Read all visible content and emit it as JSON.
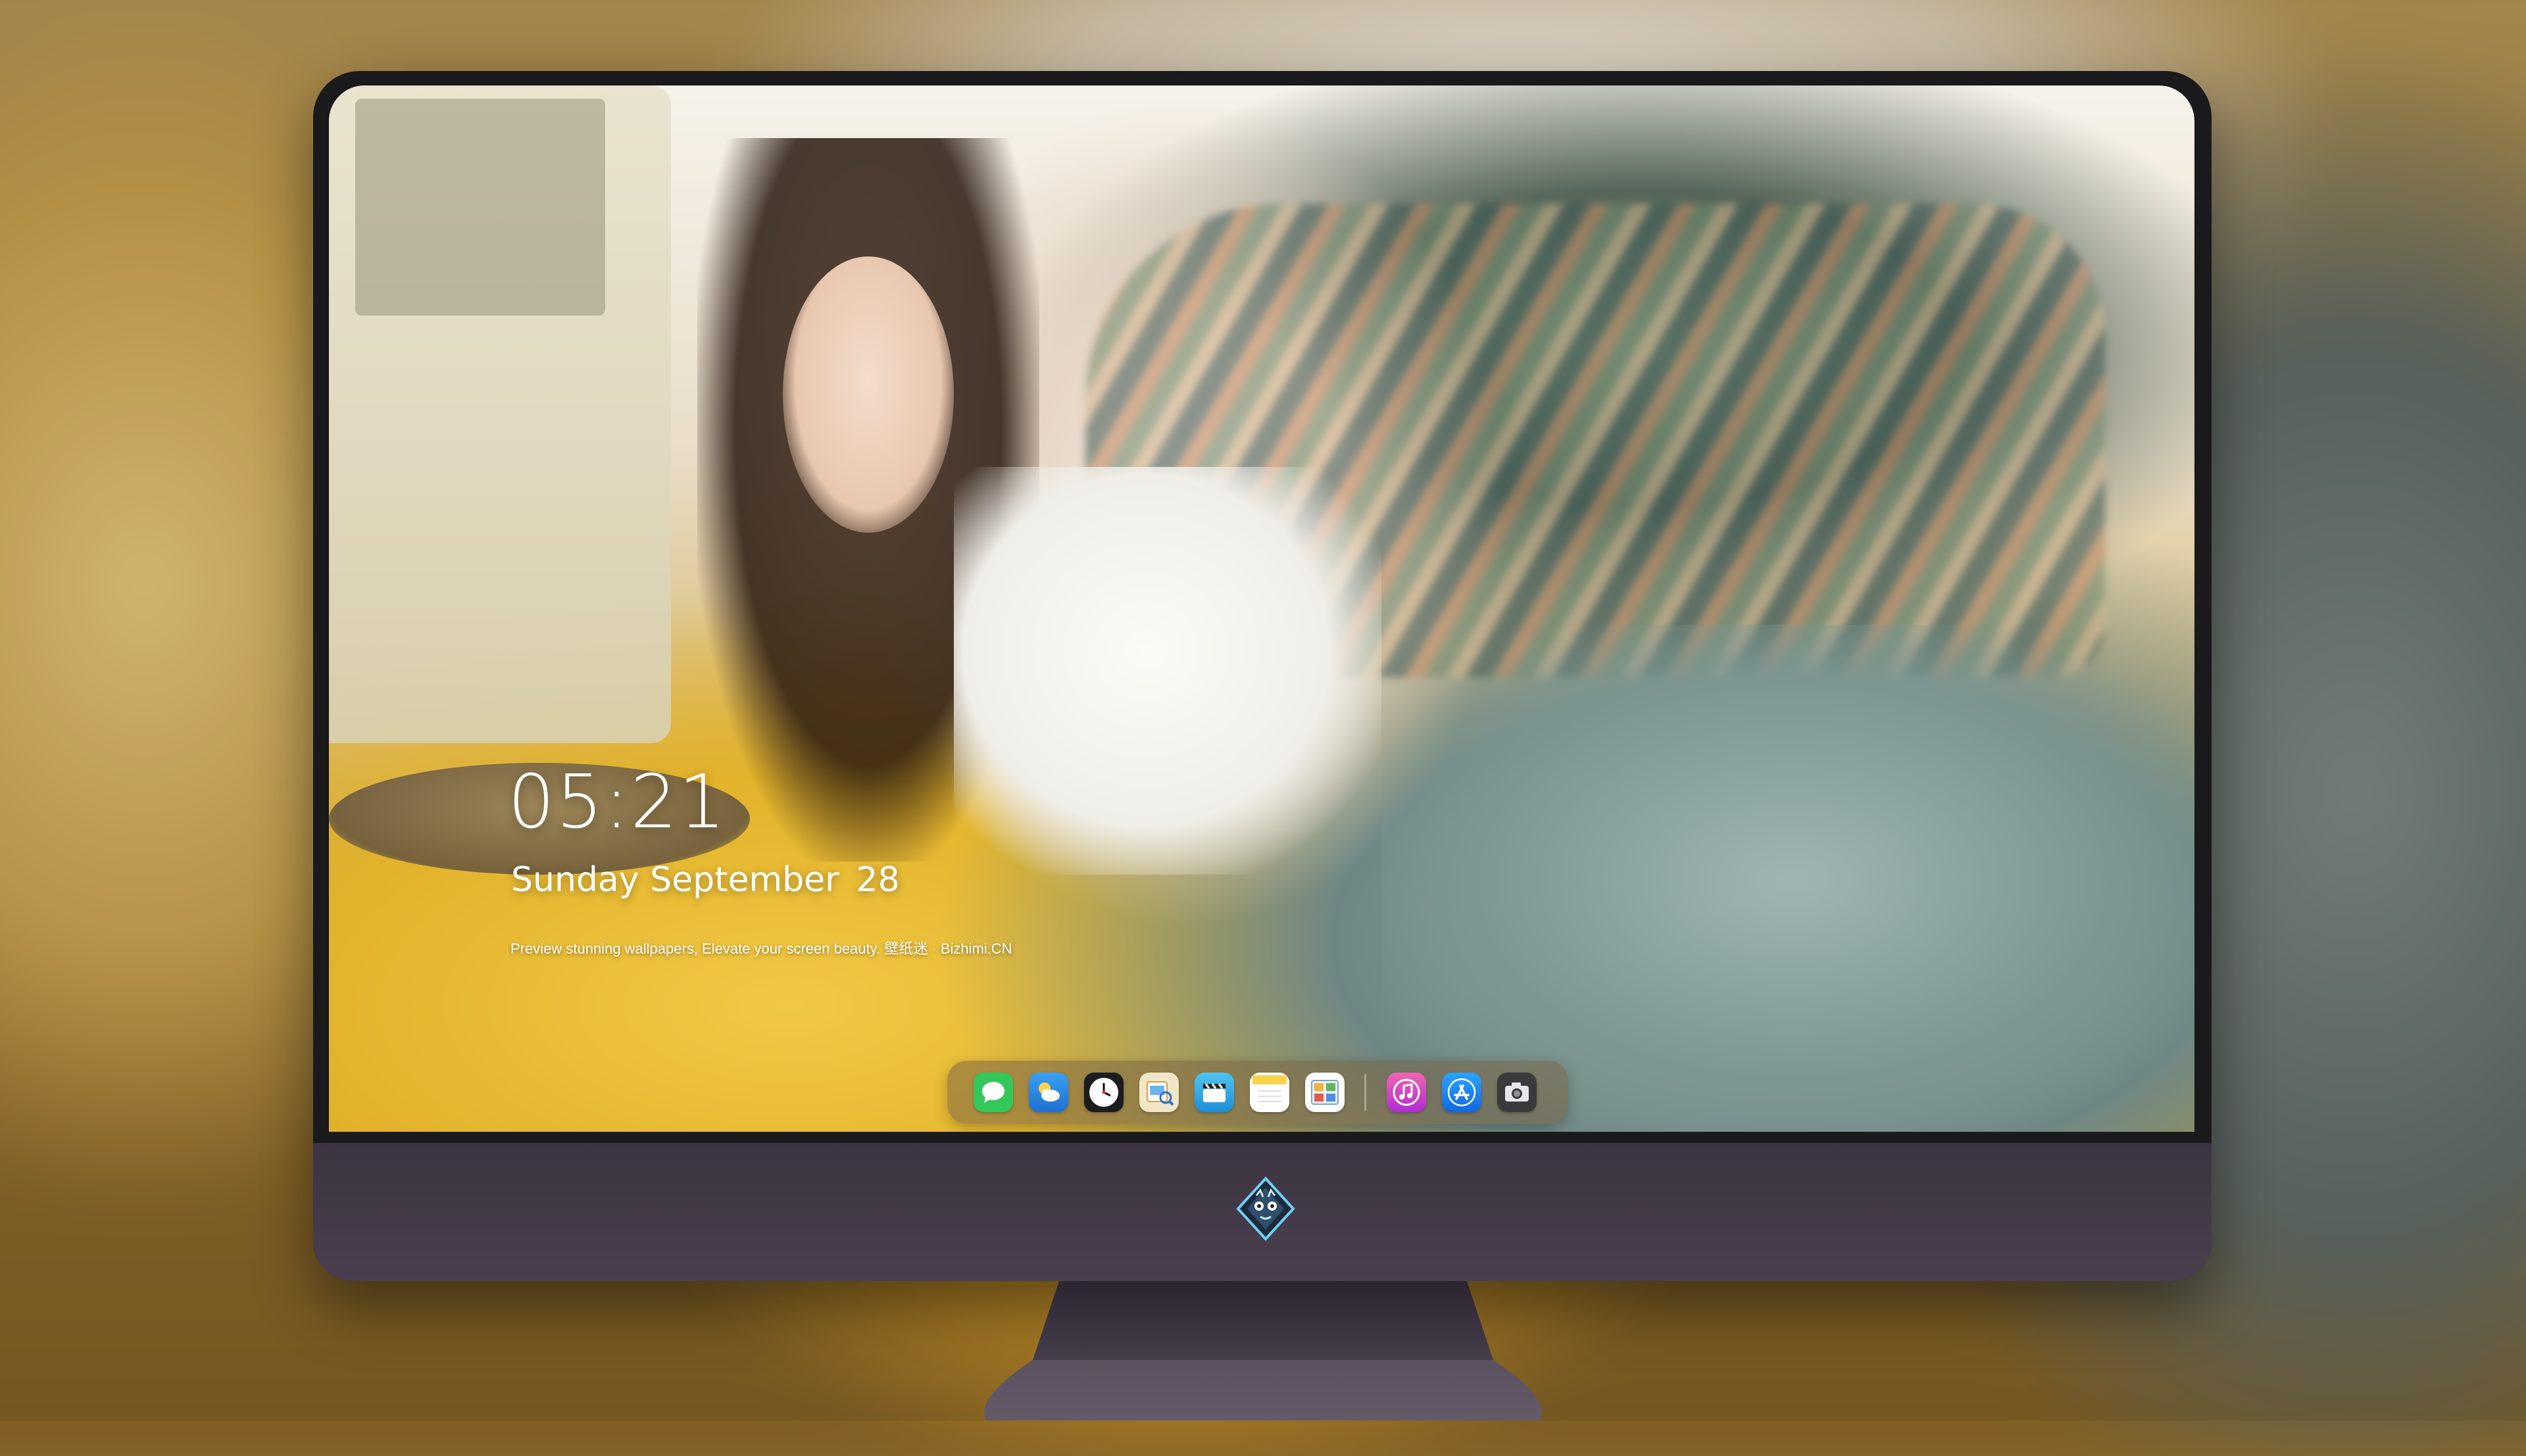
{
  "lockscreen": {
    "time": "05:21",
    "weekday_month": "Sunday September",
    "day": "28",
    "tagline": "Preview stunning wallpapers, Elevate your screen beauty. 壁纸迷 · Bizhimi.CN"
  },
  "dock": {
    "apps": [
      {
        "name": "messages",
        "icon": "message-bubble-icon",
        "color": "#34c759"
      },
      {
        "name": "weather",
        "icon": "cloud-sun-icon",
        "color": "#2f8ee5"
      },
      {
        "name": "clock",
        "icon": "clock-icon",
        "color": "#1c1c1e"
      },
      {
        "name": "preview",
        "icon": "preview-icon",
        "color": "#e6c36a"
      },
      {
        "name": "clips",
        "icon": "clapper-icon",
        "color": "#38b6e6"
      },
      {
        "name": "notes",
        "icon": "notes-icon",
        "color": "#f7d44b"
      },
      {
        "name": "photo-booth",
        "icon": "photo-icon",
        "color": "#ffffff"
      },
      {
        "name": "music",
        "icon": "music-note-icon",
        "color": "#e0408a"
      },
      {
        "name": "app-store",
        "icon": "app-store-icon",
        "color": "#1f8ff0"
      },
      {
        "name": "camera",
        "icon": "camera-icon",
        "color": "#3a3a3c"
      }
    ]
  },
  "colors": {
    "monitor_bezel": "#1a1a1c",
    "monitor_chin": "#443a49",
    "text": "#ffffff"
  }
}
